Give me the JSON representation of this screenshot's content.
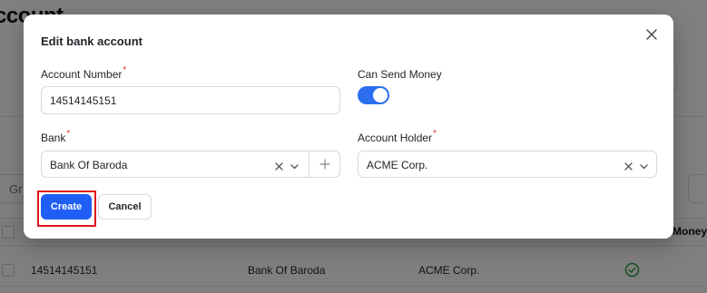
{
  "background": {
    "title": "ccount",
    "filter_placeholder": "Gr",
    "table": {
      "header_last_column": "Money",
      "rows": [
        {
          "account_number": "14514145151",
          "bank": "Bank Of Baroda",
          "account_holder": "ACME Corp.",
          "can_send_money": true
        }
      ]
    }
  },
  "modal": {
    "title": "Edit bank account",
    "fields": {
      "account_number": {
        "label": "Account Number",
        "required_mark": "*",
        "value": "14514145151"
      },
      "can_send_money": {
        "label": "Can Send Money",
        "enabled": true
      },
      "bank": {
        "label": "Bank",
        "required_mark": "*",
        "value": "Bank Of Baroda"
      },
      "account_holder": {
        "label": "Account Holder",
        "required_mark": "*",
        "value": "ACME Corp."
      }
    },
    "buttons": {
      "create": "Create",
      "cancel": "Cancel"
    }
  },
  "colors": {
    "accent": "#1f5ff5",
    "toggle_on": "#2b6ff0",
    "highlight": "#e0141b",
    "required": "#e03131",
    "success": "#2f9e44"
  },
  "icons": [
    "close-icon",
    "clear-icon",
    "chevron-down-icon",
    "plus-icon",
    "check-circle-icon"
  ]
}
